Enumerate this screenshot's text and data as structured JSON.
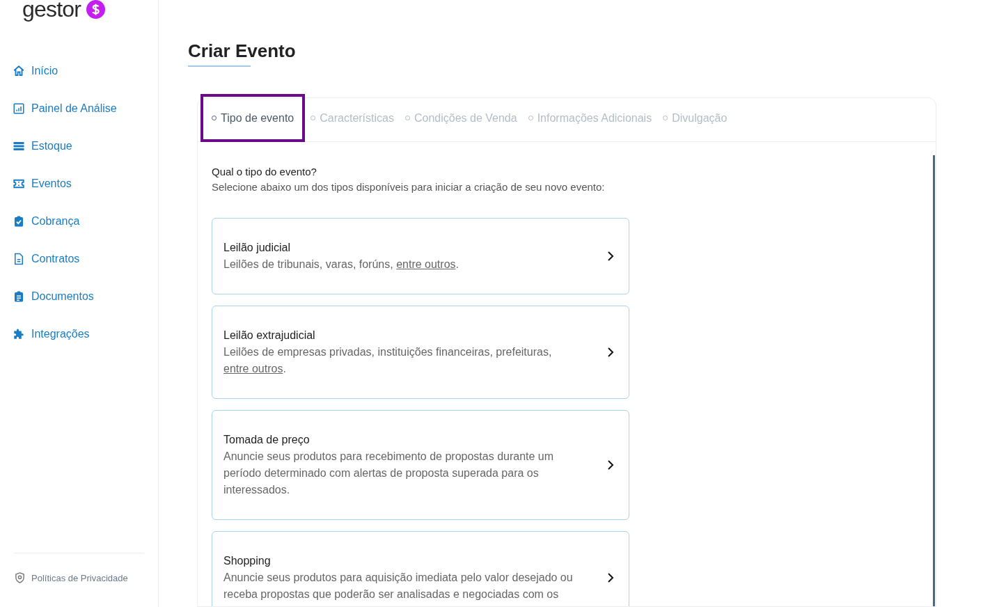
{
  "logo": {
    "text": "gestor"
  },
  "sidebar": {
    "items": [
      {
        "label": "Início"
      },
      {
        "label": "Painel de Análise"
      },
      {
        "label": "Estoque"
      },
      {
        "label": "Eventos"
      },
      {
        "label": "Cobrança"
      },
      {
        "label": "Contratos"
      },
      {
        "label": "Documentos"
      },
      {
        "label": "Integrações"
      }
    ],
    "footer_link": "Políticas de Privacidade"
  },
  "page_title": "Criar Evento",
  "steps": [
    {
      "label": "Tipo de evento",
      "selected": true
    },
    {
      "label": "Características",
      "selected": false
    },
    {
      "label": "Condições de Venda",
      "selected": false
    },
    {
      "label": "Informações Adicionais",
      "selected": false
    },
    {
      "label": "Divulgação",
      "selected": false
    }
  ],
  "question": "Qual o tipo do evento?",
  "instruction": "Selecione abaixo um dos tipos disponíveis para iniciar a criação de seu novo evento:",
  "options": [
    {
      "title": "Leilão judicial",
      "description": "Leilões de tribunais, varas, forúns, ",
      "link": "entre outros",
      "suffix": "."
    },
    {
      "title": "Leilão extrajudicial",
      "description": "Leilões de empresas privadas, instituições financeiras, prefeituras, ",
      "link": "entre outros",
      "suffix": "."
    },
    {
      "title": "Tomada de preço",
      "description": "Anuncie seus produtos para recebimento de propostas durante um período determinado com alertas de proposta superada para os interessados."
    },
    {
      "title": "Shopping",
      "description": "Anuncie seus produtos para aquisição imediata pelo valor desejado ou receba propostas que poderão ser analisadas e negociadas com os"
    }
  ]
}
